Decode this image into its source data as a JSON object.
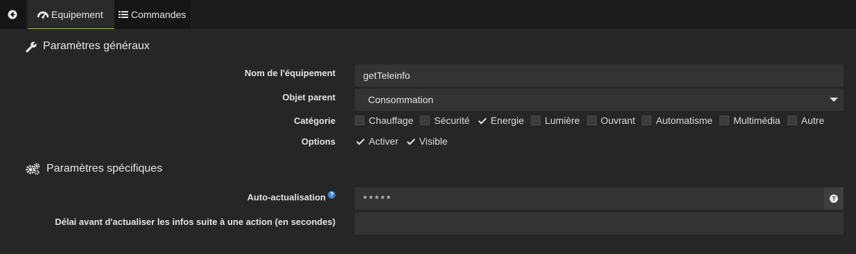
{
  "tabs": {
    "equipment": "Equipement",
    "commands": "Commandes"
  },
  "general": {
    "title": "Paramètres généraux",
    "name_label": "Nom de l'équipement",
    "name_value": "getTeleinfo",
    "parent_label": "Objet parent",
    "parent_value": "Consommation",
    "category_label": "Catégorie",
    "categories": [
      {
        "label": "Chauffage",
        "checked": false
      },
      {
        "label": "Sécurité",
        "checked": false
      },
      {
        "label": "Energie",
        "checked": true
      },
      {
        "label": "Lumière",
        "checked": false
      },
      {
        "label": "Ouvrant",
        "checked": false
      },
      {
        "label": "Automatisme",
        "checked": false
      },
      {
        "label": "Multimédia",
        "checked": false
      },
      {
        "label": "Autre",
        "checked": false
      }
    ],
    "options_label": "Options",
    "options": [
      {
        "label": "Activer",
        "checked": true
      },
      {
        "label": "Visible",
        "checked": true
      }
    ]
  },
  "specific": {
    "title": "Paramètres spécifiques",
    "autorefresh_label": "Auto-actualisation",
    "autorefresh_value": "*****",
    "delay_label": "Délai avant d'actualiser les infos suite à une action (en secondes)",
    "delay_value": ""
  },
  "colors": {
    "accent": "#9ac536",
    "help": "#3b82c8"
  }
}
